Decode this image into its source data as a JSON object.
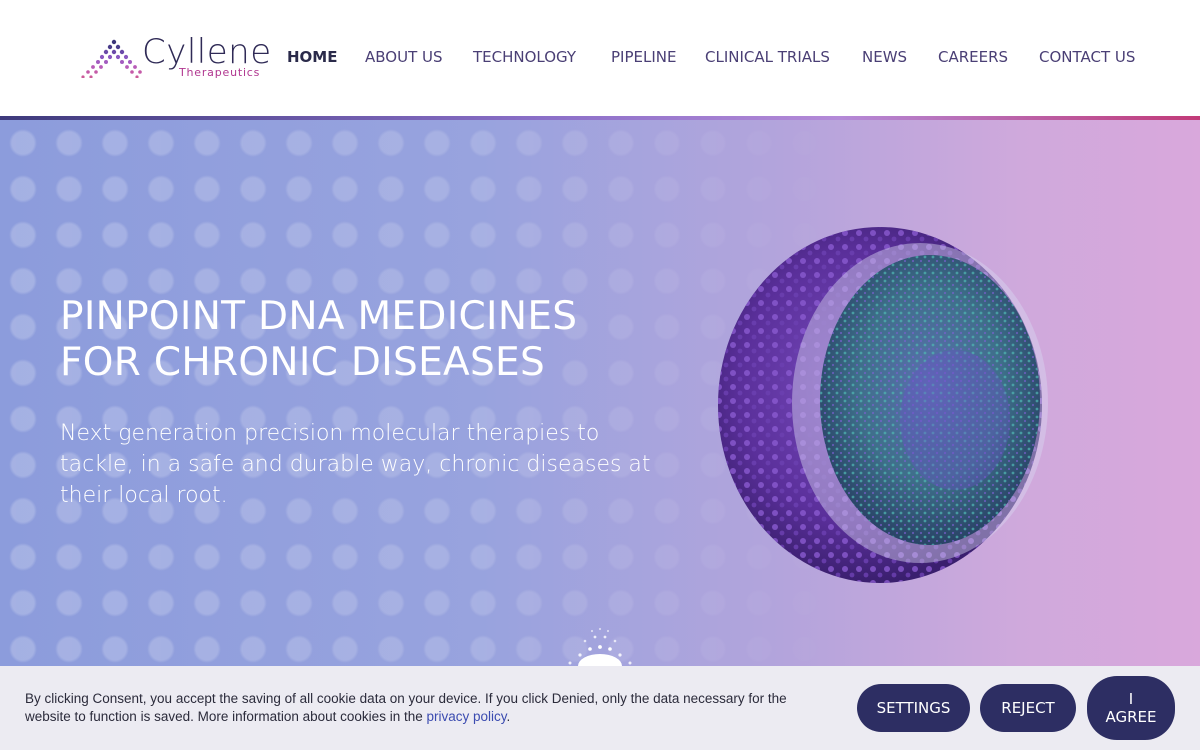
{
  "brand": {
    "name": "Cyllene",
    "subtitle": "Therapeutics",
    "colors": {
      "primary": "#2f2a56",
      "accent": "#b0358f",
      "button": "#2d2e63"
    }
  },
  "nav": {
    "items": [
      {
        "label": "HOME",
        "active": true
      },
      {
        "label": "ABOUT US"
      },
      {
        "label": "TECHNOLOGY"
      },
      {
        "label": "PIPELINE"
      },
      {
        "label": "CLINICAL TRIALS"
      },
      {
        "label": "NEWS"
      },
      {
        "label": "CAREERS"
      },
      {
        "label": "CONTACT US"
      }
    ]
  },
  "hero": {
    "title_line1": "PINPOINT DNA MEDICINES",
    "title_line2": "FOR CHRONIC DISEASES",
    "text": "Next generation precision molecular therapies to tackle, in a safe and durable way, chronic diseases at their local root.",
    "image": "lipid-nanoparticle-illustration"
  },
  "cookie": {
    "text": "By clicking Consent, you accept the saving of all cookie data on your device. If you click Denied, only the data necessary for the website to function is saved. More information about cookies in the ",
    "link": "privacy policy",
    "after_link": ".",
    "settings": "SETTINGS",
    "reject": "REJECT",
    "agree_line1": "I",
    "agree_line2": "AGREE"
  }
}
